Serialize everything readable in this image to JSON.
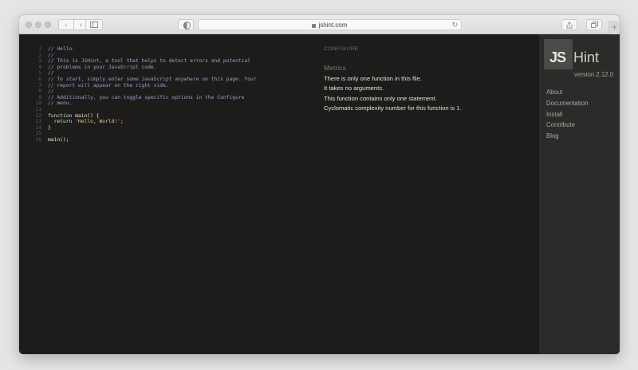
{
  "browser": {
    "url": "jshint.com",
    "new_tab_symbol": "+",
    "back_symbol": "‹",
    "forward_symbol": "›",
    "reload_symbol": "↻"
  },
  "editor": {
    "lines": [
      {
        "n": "1",
        "text": "// Hello.",
        "kind": "comment"
      },
      {
        "n": "2",
        "text": "//",
        "kind": "comment"
      },
      {
        "n": "3",
        "text": "// This is JSHint, a tool that helps to detect errors and potential",
        "kind": "comment"
      },
      {
        "n": "4",
        "text": "// problems in your JavaScript code.",
        "kind": "comment"
      },
      {
        "n": "5",
        "text": "//",
        "kind": "comment"
      },
      {
        "n": "6",
        "text": "// To start, simply enter some JavaScript anywhere on this page. Your",
        "kind": "comment"
      },
      {
        "n": "7",
        "text": "// report will appear on the right side.",
        "kind": "comment"
      },
      {
        "n": "8",
        "text": "//",
        "kind": "comment"
      },
      {
        "n": "9",
        "text": "// Additionally, you can toggle specific options in the Configure",
        "kind": "comment"
      },
      {
        "n": "10",
        "text": "// menu.",
        "kind": "comment"
      },
      {
        "n": "11",
        "text": "",
        "kind": "code"
      },
      {
        "n": "12",
        "text": "function main() {",
        "kind": "code"
      },
      {
        "n": "13",
        "text": "  return 'Hello, World!';",
        "kind": "code"
      },
      {
        "n": "14",
        "text": "}",
        "kind": "code"
      },
      {
        "n": "15",
        "text": "",
        "kind": "code"
      },
      {
        "n": "16",
        "text": "main();",
        "kind": "code"
      }
    ]
  },
  "report": {
    "configure_label": "CONFIGURE",
    "metrics_title": "Metrics",
    "metrics": [
      "There is only one function in this file.",
      "It takes no arguments.",
      "This function contains only one statement.",
      "Cyclomatic complexity number for this function is 1."
    ]
  },
  "sidebar": {
    "logo_js": "JS",
    "logo_hint": "Hint",
    "version": "version 2.12.0",
    "nav": [
      "About",
      "Documentation",
      "Install",
      "Contribute",
      "Blog"
    ]
  },
  "colors": {
    "background": "#1d1c1b",
    "sidebar": "#2c2b2a",
    "comment": "#9aa0c9",
    "keyword": "#bde3a5",
    "string": "#dbc98a"
  }
}
